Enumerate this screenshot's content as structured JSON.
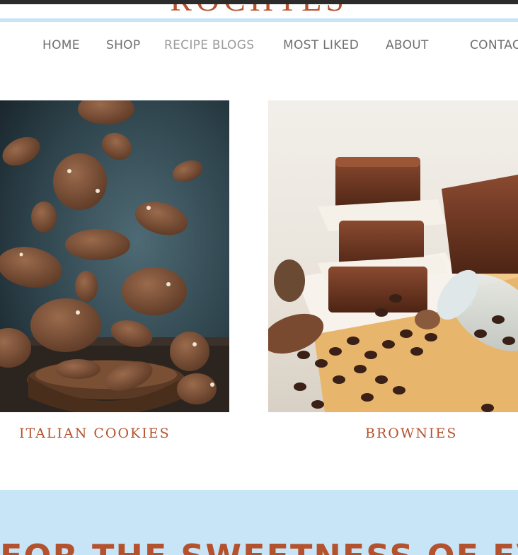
{
  "header": {
    "brand_text": "ROCHTES"
  },
  "nav": {
    "items": [
      {
        "label": "HOME"
      },
      {
        "label": "SHOP"
      },
      {
        "label": "RECIPE BLOGS"
      },
      {
        "label": "MOST LIKED"
      },
      {
        "label": "ABOUT"
      },
      {
        "label": "CONTACT"
      }
    ]
  },
  "recipes": [
    {
      "title": "ITALIAN COOKIES",
      "image_alt": "Chocolate cookies falling into a bowl"
    },
    {
      "title": "BROWNIES",
      "image_alt": "Stacked brownies with coffee beans and a jar"
    }
  ],
  "banner": {
    "headline": "FOR THE SWEETNESS OF EVERY"
  },
  "colors": {
    "accent": "#b5522e",
    "nav_text": "#6f6f6f",
    "light_blue": "#c8e4f7",
    "top_bar": "#2b2b2b"
  }
}
